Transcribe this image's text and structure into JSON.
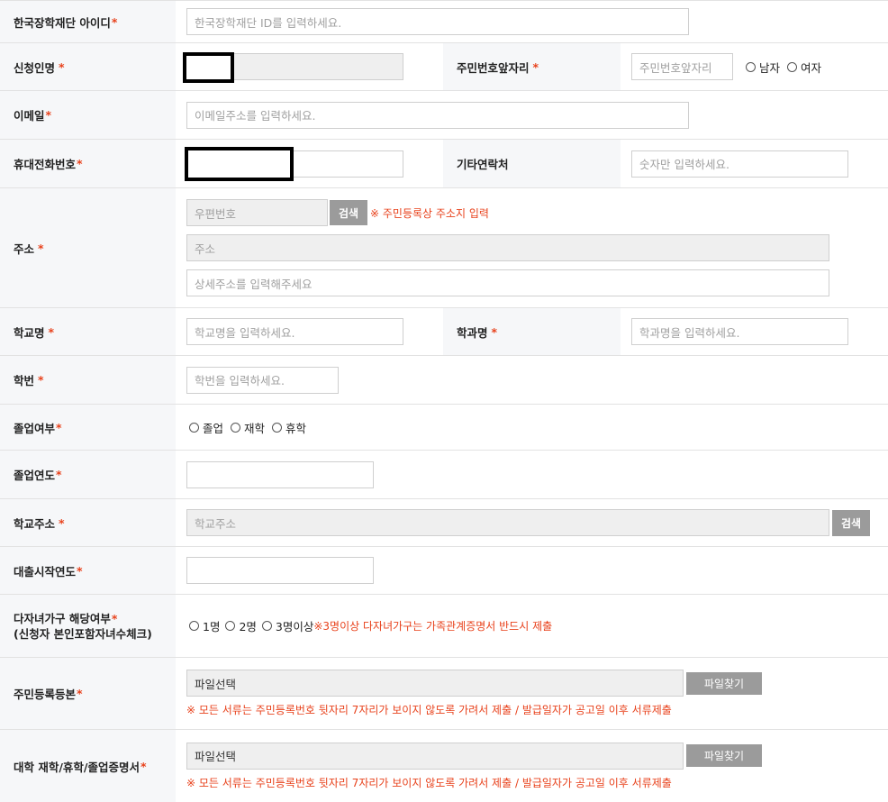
{
  "fields": {
    "kosaf_id": {
      "label": "한국장학재단 아이디",
      "placeholder": "한국장학재단 ID를 입력하세요."
    },
    "name": {
      "label": "신청인명"
    },
    "resident_front": {
      "label": "주민번호앞자리",
      "placeholder": "주민번호앞자리",
      "options": [
        "남자",
        "여자"
      ]
    },
    "email": {
      "label": "이메일",
      "placeholder": "이메일주소를 입력하세요."
    },
    "mobile": {
      "label": "휴대전화번호"
    },
    "other_contact": {
      "label": "기타연락처",
      "placeholder": "숫자만 입력하세요."
    },
    "address": {
      "label": "주소",
      "zip_placeholder": "우편번호",
      "search_label": "검색",
      "note": "※ 주민등록상 주소지 입력",
      "addr_placeholder": "주소",
      "detail_placeholder": "상세주소를 입력해주세요"
    },
    "school": {
      "label": "학교명",
      "placeholder": "학교명을 입력하세요."
    },
    "department": {
      "label": "학과명",
      "placeholder": "학과명을 입력하세요."
    },
    "student_no": {
      "label": "학번",
      "placeholder": "학번을 입력하세요."
    },
    "graduation": {
      "label": "졸업여부",
      "options": [
        "졸업",
        "재학",
        "휴학"
      ]
    },
    "grad_year": {
      "label": "졸업연도"
    },
    "school_addr": {
      "label": "학교주소",
      "placeholder": "학교주소",
      "search_label": "검색"
    },
    "loan_year": {
      "label": "대출시작연도"
    },
    "multi_child": {
      "label_line1": "다자녀가구 해당여부",
      "label_line2": "(신청자 본인포함자녀수체크)",
      "options": [
        "1명",
        "2명",
        "3명이상"
      ],
      "note": "※3명이상 다자녀가구는 가족관계증명서 반드시 제출"
    },
    "resident_doc": {
      "label": "주민등록등본",
      "file_placeholder": "파일선택",
      "find_label": "파일찾기",
      "note": "※ 모든 서류는 주민등록번호 뒷자리 7자리가 보이지 않도록 가려서 제출 / 발급일자가 공고일 이후 서류제출"
    },
    "univ_doc": {
      "label": "대학 재학/휴학/졸업증명서",
      "file_placeholder": "파일선택",
      "find_label": "파일찾기",
      "note": "※ 모든 서류는 주민등록번호 뒷자리 7자리가 보이지 않도록 가려서 제출 / 발급일자가 공고일 이후 서류제출"
    }
  },
  "required_mark": "*",
  "colors": {
    "required": "#e8421c",
    "header_bg": "#f6f7f9",
    "button": "#9b9b9b"
  }
}
